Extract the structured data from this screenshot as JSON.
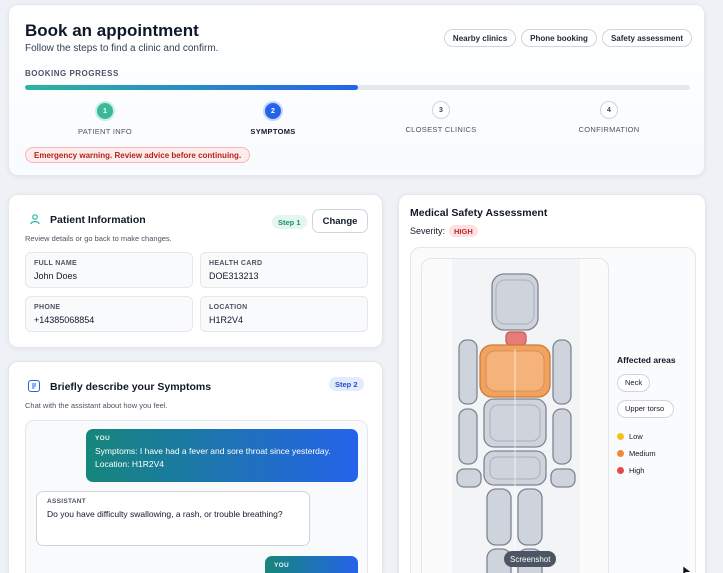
{
  "header": {
    "title": "Book an appointment",
    "subtitle": "Follow the steps to find a clinic and confirm.",
    "chips": [
      "Nearby clinics",
      "Phone booking",
      "Safety assessment"
    ],
    "progress_label": "BOOKING PROGRESS",
    "progress_fraction": 0.5,
    "steps": [
      {
        "number": "1",
        "label": "PATIENT INFO",
        "state": "done"
      },
      {
        "number": "2",
        "label": "SYMPTOMS",
        "state": "active"
      },
      {
        "number": "3",
        "label": "CLOSEST CLINICS",
        "state": "pending"
      },
      {
        "number": "4",
        "label": "CONFIRMATION",
        "state": "pending"
      }
    ],
    "warning": "Emergency warning. Review advice before continuing."
  },
  "patient": {
    "title": "Patient Information",
    "subtitle": "Review details or go back to make changes.",
    "step_tag": "Step 1",
    "change_label": "Change",
    "fields": [
      {
        "label": "FULL NAME",
        "value": "John Does"
      },
      {
        "label": "HEALTH CARD",
        "value": "DOE313213"
      },
      {
        "label": "PHONE",
        "value": "+14385068854"
      },
      {
        "label": "LOCATION",
        "value": "H1R2V4"
      }
    ]
  },
  "symptoms": {
    "title": "Briefly describe your Symptoms",
    "subtitle": "Chat with the assistant about how you feel.",
    "step_tag": "Step 2",
    "messages": [
      {
        "sender": "YOU",
        "text": "Symptoms: I have had a fever and sore throat since yesterday. Location: H1R2V4"
      },
      {
        "sender": "ASSISTANT",
        "text": "Do you have difficulty swallowing, a rash, or trouble breathing?"
      },
      {
        "sender": "YOU",
        "text": ""
      }
    ]
  },
  "safety": {
    "title": "Medical Safety Assessment",
    "severity_label": "Severity:",
    "severity_value": "HIGH",
    "legend_title": "Affected areas",
    "affected_areas": [
      "Neck",
      "Upper torso"
    ],
    "levels": [
      {
        "label": "Low",
        "color": "#f4c21b"
      },
      {
        "label": "Medium",
        "color": "#f08a3a"
      },
      {
        "label": "High",
        "color": "#e5484d"
      }
    ]
  },
  "colors": {
    "accent": "#2563eb",
    "teal": "#3bb89a",
    "medium_area": "#f0a360",
    "high_area": "#e77b79"
  },
  "tooltip": "Screenshot"
}
